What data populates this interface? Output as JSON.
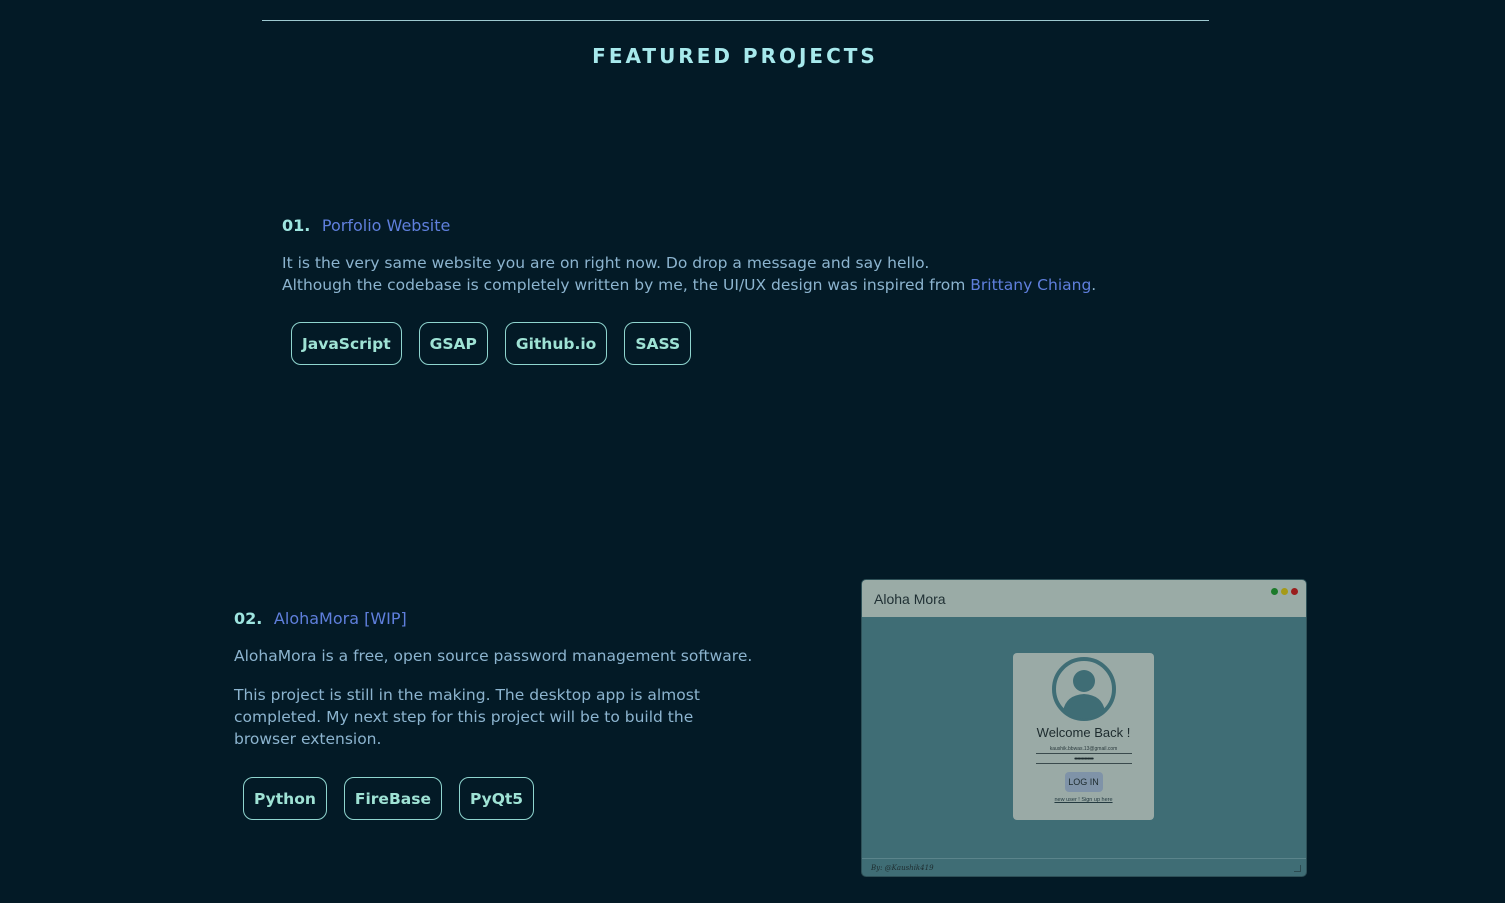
{
  "section": {
    "title": "FEATURED PROJECTS"
  },
  "projects": [
    {
      "number": "01.",
      "name": "Porfolio Website",
      "desc_line1": "It is the very same website you are on right now. Do drop a message and say hello.",
      "desc_line2_pre": "Although the codebase is completely written by me, the UI/UX design was inspired from ",
      "desc_link": "Brittany Chiang",
      "desc_line2_post": ".",
      "tags": [
        "JavaScript",
        "GSAP",
        "Github.io",
        "SASS"
      ]
    },
    {
      "number": "02.",
      "name": "AlohaMora [WIP]",
      "desc_para1": "AlohaMora is a free, open source password management software.",
      "desc_para2": "This project is still in the making. The desktop app is almost completed. My next step for this project will be to build the browser extension.",
      "tags": [
        "Python",
        "FireBase",
        "PyQt5"
      ]
    }
  ],
  "preview": {
    "window_title": "Aloha Mora",
    "dot_colors": [
      "#1c7a2a",
      "#a59a17",
      "#9a1d1d"
    ],
    "welcome": "Welcome Back !",
    "email": "kaushik.bbwas.13@gmail.com",
    "password": "•••••••••••••",
    "login_label": "LOG IN",
    "signup_text": "new user ! Sign up here",
    "footer_text": "By: @Kaushik419"
  },
  "colors": {
    "background": "#031a26",
    "accent": "#9ee5e0",
    "link": "#5f7fdc",
    "text": "#8cb4cf"
  }
}
